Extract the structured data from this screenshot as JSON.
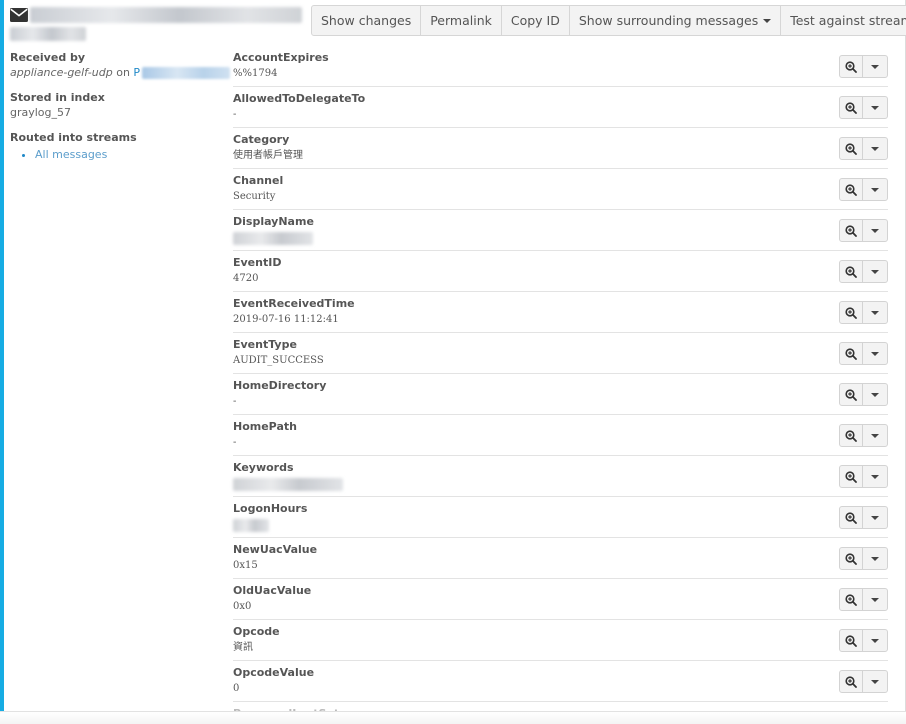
{
  "header": {
    "icon": "envelope-icon",
    "toolbar": [
      {
        "name": "show-changes-button",
        "label": "Show changes",
        "dropdown": false
      },
      {
        "name": "permalink-button",
        "label": "Permalink",
        "dropdown": false
      },
      {
        "name": "copy-id-button",
        "label": "Copy ID",
        "dropdown": false
      },
      {
        "name": "show-surrounding-messages-button",
        "label": "Show surrounding messages",
        "dropdown": true
      },
      {
        "name": "test-against-stream-button",
        "label": "Test against stream",
        "dropdown": true
      }
    ]
  },
  "meta": {
    "received_label": "Received by",
    "received_input": "appliance-gelf-udp",
    "received_on": "on",
    "received_node_prefix": "P",
    "stored_label": "Stored in index",
    "stored_value": "graylog_57",
    "routed_label": "Routed into streams",
    "streams": [
      "All messages"
    ]
  },
  "fields": [
    {
      "name": "AccountExpires",
      "value": "%%1794"
    },
    {
      "name": "AllowedToDelegateTo",
      "value": "-"
    },
    {
      "name": "Category",
      "value": "使用者帳戶管理"
    },
    {
      "name": "Channel",
      "value": "Security"
    },
    {
      "name": "DisplayName",
      "value": ""
    },
    {
      "name": "EventID",
      "value": "4720"
    },
    {
      "name": "EventReceivedTime",
      "value": "2019-07-16 11:12:41"
    },
    {
      "name": "EventType",
      "value": "AUDIT_SUCCESS"
    },
    {
      "name": "HomeDirectory",
      "value": "-"
    },
    {
      "name": "HomePath",
      "value": "-"
    },
    {
      "name": "Keywords",
      "value": ""
    },
    {
      "name": "LogonHours",
      "value": ""
    },
    {
      "name": "NewUacValue",
      "value": "0x15"
    },
    {
      "name": "OldUacValue",
      "value": "0x0"
    },
    {
      "name": "Opcode",
      "value": "資訊"
    },
    {
      "name": "OpcodeValue",
      "value": "0"
    },
    {
      "name": "PasswordLastSet",
      "value": ""
    }
  ],
  "colors": {
    "accent": "#16ace3",
    "link": "#1f88c7"
  }
}
